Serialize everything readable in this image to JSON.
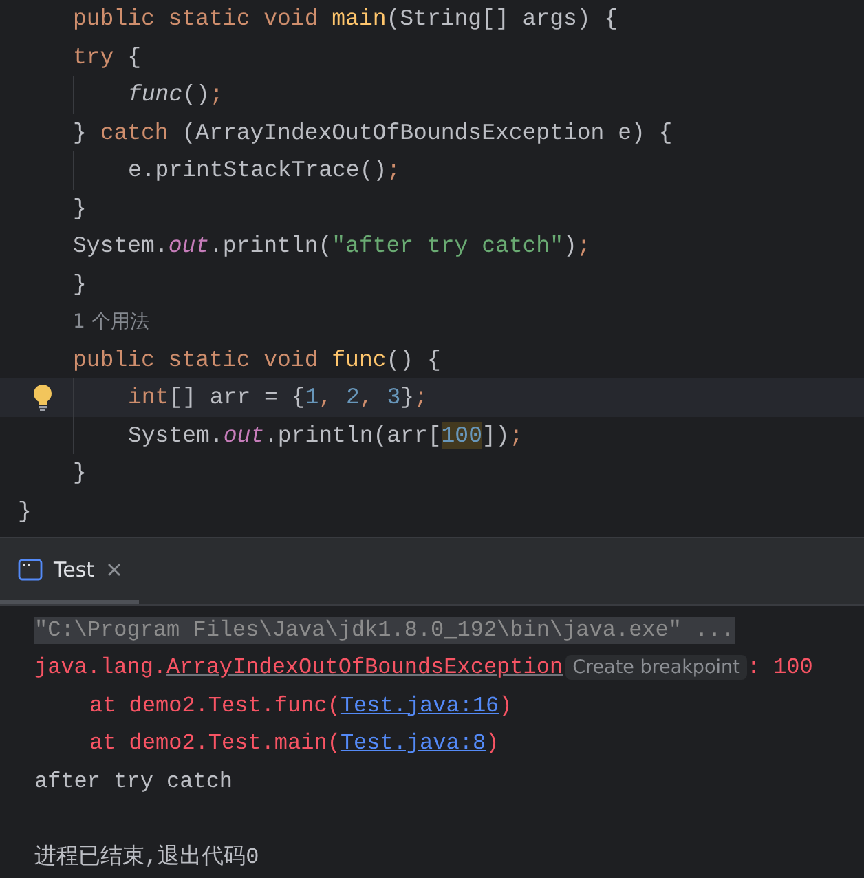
{
  "editor": {
    "body": [
      {
        "kind": "code",
        "tokens": [
          {
            "kind": "keyword",
            "text": "public static void "
          },
          {
            "kind": "method",
            "text": "main"
          },
          {
            "kind": "plain",
            "text": "(String[] args) {"
          }
        ]
      },
      {
        "kind": "code",
        "tokens": [
          {
            "kind": "keyword",
            "text": "try "
          },
          {
            "kind": "plain",
            "text": "{"
          }
        ],
        "children": [
          {
            "kind": "code",
            "tokens": [
              {
                "kind": "call",
                "text": "func"
              },
              {
                "kind": "plain",
                "text": "()"
              },
              {
                "kind": "keyword",
                "text": ";"
              }
            ]
          }
        ]
      },
      {
        "kind": "code",
        "tokens": [
          {
            "kind": "plain",
            "text": "} "
          },
          {
            "kind": "keyword",
            "text": "catch "
          },
          {
            "kind": "plain",
            "text": "(ArrayIndexOutOfBoundsException e) {"
          }
        ],
        "children": [
          {
            "kind": "code",
            "tokens": [
              {
                "kind": "plain",
                "text": "e.printStackTrace()"
              },
              {
                "kind": "keyword",
                "text": ";"
              }
            ]
          }
        ]
      },
      {
        "kind": "code",
        "tokens": [
          {
            "kind": "plain",
            "text": "}"
          }
        ]
      },
      {
        "kind": "code",
        "tokens": [
          {
            "kind": "plain",
            "text": "System."
          },
          {
            "kind": "field",
            "text": "out"
          },
          {
            "kind": "plain",
            "text": ".println("
          },
          {
            "kind": "string",
            "text": "\"after try catch\""
          },
          {
            "kind": "plain",
            "text": ")"
          },
          {
            "kind": "keyword",
            "text": ";"
          }
        ]
      },
      {
        "kind": "code",
        "tokens": [
          {
            "kind": "plain",
            "text": "}"
          }
        ]
      },
      {
        "kind": "hint",
        "text": "1 个用法"
      },
      {
        "kind": "code",
        "tokens": [
          {
            "kind": "keyword",
            "text": "public static void "
          },
          {
            "kind": "method",
            "text": "func"
          },
          {
            "kind": "plain",
            "text": "() {"
          }
        ],
        "children": [
          {
            "kind": "code",
            "current": true,
            "bulb": true,
            "tokens": [
              {
                "kind": "keyword",
                "text": "int"
              },
              {
                "kind": "plain",
                "text": "[] arr = {"
              },
              {
                "kind": "number",
                "text": "1"
              },
              {
                "kind": "keyword",
                "text": ", "
              },
              {
                "kind": "number",
                "text": "2"
              },
              {
                "kind": "keyword",
                "text": ", "
              },
              {
                "kind": "number",
                "text": "3"
              },
              {
                "kind": "plain",
                "text": "}"
              },
              {
                "kind": "keyword",
                "text": ";"
              }
            ]
          },
          {
            "kind": "code",
            "tokens": [
              {
                "kind": "plain",
                "text": "System."
              },
              {
                "kind": "field",
                "text": "out"
              },
              {
                "kind": "plain",
                "text": ".println(arr["
              },
              {
                "kind": "matched-number",
                "text": "100"
              },
              {
                "kind": "plain",
                "text": "])"
              },
              {
                "kind": "keyword",
                "text": ";"
              }
            ]
          }
        ]
      },
      {
        "kind": "code",
        "tokens": [
          {
            "kind": "plain",
            "text": "}"
          }
        ]
      }
    ],
    "closing": [
      {
        "kind": "code",
        "tokens": [
          {
            "kind": "plain",
            "text": "}"
          }
        ]
      }
    ]
  },
  "run_panel": {
    "tabs": [
      {
        "label": "Test",
        "selected": true
      }
    ],
    "console": [
      {
        "kind": "text",
        "segments": [
          {
            "kind": "command",
            "text": "\"C:\\Program Files\\Java\\jdk1.8.0_192\\bin\\java.exe\" ..."
          }
        ]
      },
      {
        "kind": "text",
        "segments": [
          {
            "kind": "error",
            "text": "java.lang."
          },
          {
            "kind": "hover-link",
            "text": "ArrayIndexOutOfBoundsException"
          },
          {
            "kind": "chip",
            "text": "Create breakpoint"
          },
          {
            "kind": "error",
            "text": ": 100"
          }
        ],
        "children": [
          {
            "kind": "text",
            "segments": [
              {
                "kind": "error",
                "text": "at demo2.Test.func("
              },
              {
                "kind": "link",
                "text": "Test.java:16"
              },
              {
                "kind": "error",
                "text": ")"
              }
            ]
          },
          {
            "kind": "text",
            "segments": [
              {
                "kind": "error",
                "text": "at demo2.Test.main("
              },
              {
                "kind": "link",
                "text": "Test.java:8"
              },
              {
                "kind": "error",
                "text": ")"
              }
            ]
          }
        ]
      },
      {
        "kind": "text",
        "segments": [
          {
            "kind": "output",
            "text": "after try catch"
          }
        ]
      },
      {
        "kind": "blank"
      },
      {
        "kind": "text",
        "segments": [
          {
            "kind": "output",
            "text": "进程已结束,退出代码0"
          }
        ]
      }
    ]
  }
}
